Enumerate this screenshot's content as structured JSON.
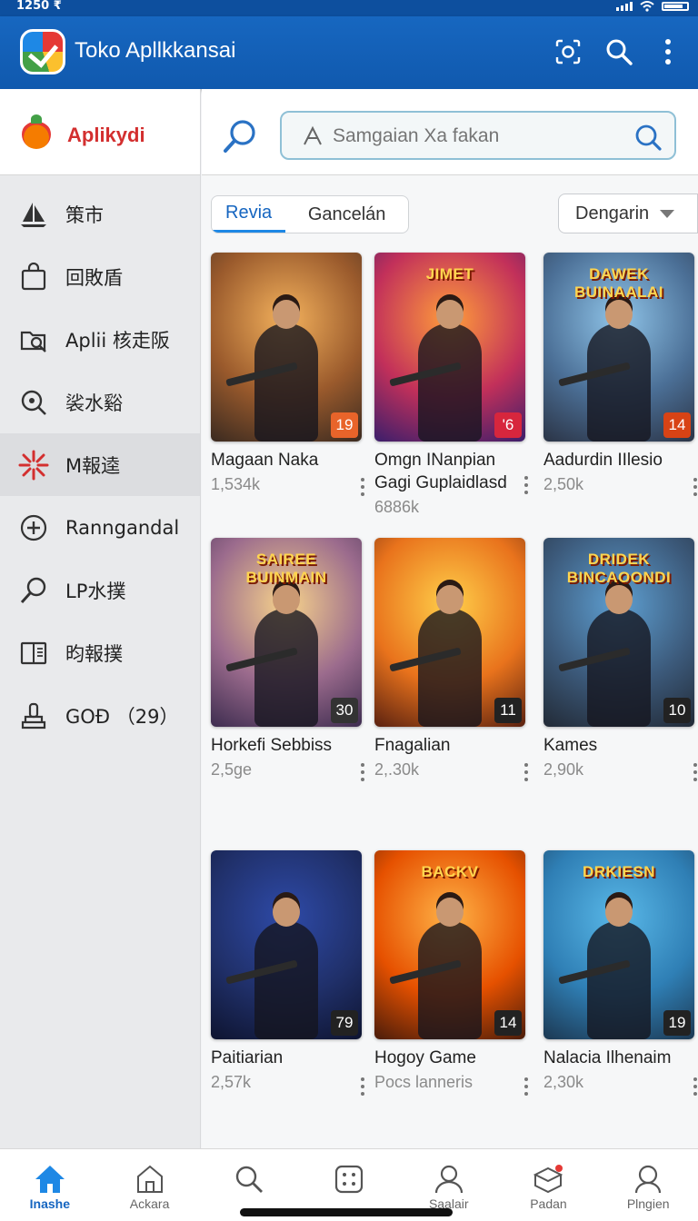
{
  "status_bar": {
    "time": "1250 ₹"
  },
  "app_bar": {
    "title": "Toko Apllkkansai",
    "actions": [
      "qr-scan-icon",
      "search-icon",
      "more-vert-icon"
    ]
  },
  "sidebar": {
    "brand": "Aplikydi",
    "items": [
      {
        "label": "策市",
        "icon": "sailboat-icon"
      },
      {
        "label": "回敗盾",
        "icon": "bag-icon"
      },
      {
        "label": "Aplii 核走阪",
        "icon": "folder-search-icon"
      },
      {
        "label": "裟水谿",
        "icon": "zoom-icon"
      },
      {
        "label": "M報逵",
        "icon": "burst-icon",
        "active": true
      },
      {
        "label": "Ranngandal",
        "icon": "add-circle-icon"
      },
      {
        "label": "LP水撲",
        "icon": "magnifier-icon"
      },
      {
        "label": "昀報撲",
        "icon": "book-icon"
      },
      {
        "label": "GOĐ （29）",
        "icon": "trophy-icon"
      }
    ]
  },
  "search": {
    "placeholder": "Samgaian Xa fakan"
  },
  "tabs": [
    "Revia",
    "Gancelán"
  ],
  "active_tab": "Revia",
  "sort": {
    "selected": "Dengarin"
  },
  "apps": [
    {
      "name": "Magaan Naka",
      "meta": [
        "1,534k"
      ],
      "badge": "19",
      "banner": "",
      "colors": [
        "#f3b15c",
        "#9a5a2c",
        "#3a2a20"
      ],
      "badge_color": "#e8642a"
    },
    {
      "name": "Omgn INanpian",
      "name2": "Gagi Guplaidlasd",
      "meta": [
        "6886k"
      ],
      "badge": "'6",
      "banner": "JIMET",
      "colors": [
        "#ff9d3b",
        "#c2305a",
        "#3b1e6b"
      ],
      "badge_color": "#d7263d"
    },
    {
      "name": "Aadurdin IIlesio",
      "meta": [
        "2,50k"
      ],
      "badge": "14",
      "banner": "DAWEK BUINAALAI",
      "colors": [
        "#8fc4e8",
        "#4b6f96",
        "#2b3446"
      ],
      "badge_color": "#d84315"
    },
    {
      "name": "Horkefi Sebbiss",
      "meta": [
        "2,5ge"
      ],
      "badge": "30",
      "banner": "SAIREE BUINMAIN",
      "colors": [
        "#f7d38b",
        "#9b6b8d",
        "#3d2c4f"
      ],
      "badge_color": "#333333"
    },
    {
      "name": "Fnagalian",
      "meta": [
        "2,.30k"
      ],
      "badge": "11",
      "banner": "",
      "colors": [
        "#ffcf4a",
        "#e9731c",
        "#5a2110"
      ],
      "badge_color": "#222222"
    },
    {
      "name": "Kames",
      "meta": [
        "2,90k"
      ],
      "badge": "10",
      "banner": "DRIDEK BINCAOONDI",
      "colors": [
        "#5e9fd1",
        "#3c5a7b",
        "#222a36"
      ],
      "badge_color": "#222222"
    },
    {
      "name": "Paitiarian",
      "meta": [
        "2,57k"
      ],
      "badge": "79",
      "banner": "",
      "colors": [
        "#2e4aa8",
        "#20306a",
        "#0e1430"
      ],
      "badge_color": "#222222"
    },
    {
      "name": "Hogoy Game",
      "meta": [
        "Pocs lanneris"
      ],
      "badge": "14",
      "banner": "BACKV",
      "colors": [
        "#ffb347",
        "#e65100",
        "#4a1c0a"
      ],
      "badge_color": "#222222"
    },
    {
      "name": "Nalacia Ilhenaim",
      "meta": [
        "2,30k"
      ],
      "badge": "19",
      "banner": "DRKIESN",
      "colors": [
        "#59b8e8",
        "#2f7fb5",
        "#1c3852"
      ],
      "badge_color": "#222222"
    }
  ],
  "bottom_nav": [
    {
      "label": "Inashe",
      "icon": "home-icon",
      "active": true
    },
    {
      "label": "Ackara",
      "icon": "store-icon"
    },
    {
      "label": "",
      "icon": "search-icon"
    },
    {
      "label": "",
      "icon": "apps-icon"
    },
    {
      "label": "Saalair",
      "icon": "person-icon"
    },
    {
      "label": "Padan",
      "icon": "inbox-icon"
    },
    {
      "label": "Plngien",
      "icon": "profile-icon"
    }
  ]
}
